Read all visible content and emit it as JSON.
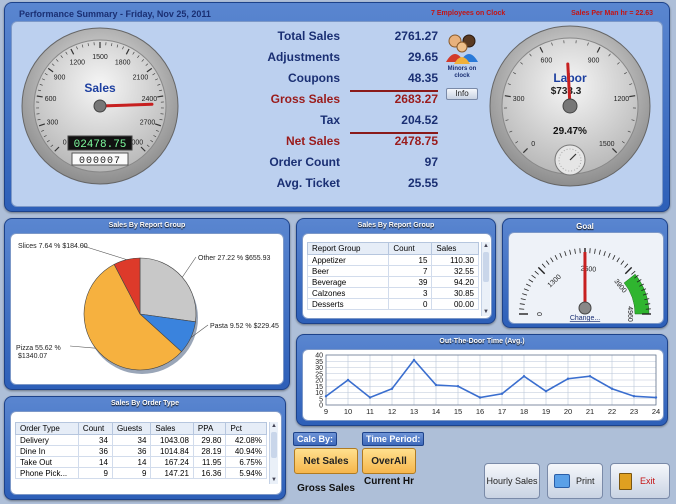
{
  "header": {
    "title": "Performance Summary - Friday, Nov 25, 2011",
    "employees": "7 Employees on Clock",
    "sales_per_man_hr": "Sales Per Man hr = 22.63"
  },
  "sales_gauge": {
    "label": "Sales",
    "ticks": [
      "0",
      "300",
      "600",
      "900",
      "1200",
      "1500",
      "1800",
      "2100",
      "2400",
      "2700",
      "3000"
    ],
    "value": 2478.75,
    "digital": "02478.75",
    "odometer": "000007"
  },
  "summary": [
    {
      "label": "Total Sales",
      "value": "2761.27",
      "style": "blue"
    },
    {
      "label": "Adjustments",
      "value": "29.65",
      "style": "blue"
    },
    {
      "label": "Coupons",
      "value": "48.35",
      "style": "blue"
    },
    {
      "label": "Gross Sales",
      "value": "2683.27",
      "style": "red"
    },
    {
      "label": "Tax",
      "value": "204.52",
      "style": "blue"
    },
    {
      "label": "Net Sales",
      "value": "2478.75",
      "style": "red"
    },
    {
      "label": "Order Count",
      "value": "97",
      "style": "blue"
    },
    {
      "label": "Avg. Ticket",
      "value": "25.55",
      "style": "blue"
    }
  ],
  "minors": {
    "label": "Minors on clock",
    "info_button": "Info"
  },
  "labor_gauge": {
    "label": "Labor",
    "amount": "$733.3",
    "ticks": [
      "0",
      "300",
      "600",
      "900",
      "1200",
      "1500"
    ],
    "percent": "29.47%",
    "value": 733.3
  },
  "pie": {
    "title": "Sales By Report Group",
    "chart_data": {
      "type": "pie",
      "slices": [
        {
          "name": "Other",
          "pct": 27.22,
          "amount": "$655.93",
          "label": "Other  27.22 % $655.93",
          "color": "#c8c8c8"
        },
        {
          "name": "Pasta",
          "pct": 9.52,
          "amount": "$229.45",
          "label": "Pasta 9.52 % $229.45",
          "color": "#3a83dd"
        },
        {
          "name": "Pizza",
          "pct": 55.62,
          "amount": "$1340.07",
          "label": "Pizza 55.62 % $1340.07",
          "color": "#f6b13f"
        },
        {
          "name": "Slices",
          "pct": 7.64,
          "amount": "$184.00",
          "label": "Slices 7.64 % $184.00",
          "color": "#dd3a2a"
        }
      ]
    }
  },
  "report_table": {
    "title": "Sales By Report Group",
    "headers": [
      "Report Group",
      "Count",
      "Sales"
    ],
    "rows": [
      [
        "Appetizer",
        "15",
        "110.30"
      ],
      [
        "Beer",
        "7",
        "32.55"
      ],
      [
        "Beverage",
        "39",
        "94.20"
      ],
      [
        "Calzones",
        "3",
        "30.85"
      ],
      [
        "Desserts",
        "0",
        "00.00"
      ]
    ]
  },
  "goal": {
    "title": "Goal",
    "ticks": [
      "0",
      "1300",
      "2600",
      "3900",
      "4960"
    ],
    "value": 2478.75,
    "change_link": "Change..."
  },
  "otd": {
    "title": "Out-The-Door Time (Avg.)",
    "chart_data": {
      "type": "line",
      "x": [
        9,
        10,
        11,
        12,
        13,
        14,
        15,
        16,
        17,
        18,
        19,
        20,
        21,
        22,
        23,
        24
      ],
      "y": [
        7,
        20,
        6,
        13,
        36,
        16,
        15,
        6,
        9,
        23,
        11,
        21,
        23,
        13,
        7,
        6
      ],
      "ylim": [
        0,
        40
      ],
      "yticks": [
        0,
        5,
        10,
        15,
        20,
        25,
        30,
        35,
        40
      ],
      "grid": true
    }
  },
  "order_table": {
    "title": "Sales By Order Type",
    "headers": [
      "Order Type",
      "Count",
      "Guests",
      "Sales",
      "PPA",
      "Pct"
    ],
    "rows": [
      [
        "Delivery",
        "34",
        "34",
        "1043.08",
        "29.80",
        "42.08%"
      ],
      [
        "Dine In",
        "36",
        "36",
        "1014.84",
        "28.19",
        "40.94%"
      ],
      [
        "Take Out",
        "14",
        "14",
        "167.24",
        "11.95",
        "6.75%"
      ],
      [
        "Phone Pick...",
        "9",
        "9",
        "147.21",
        "16.36",
        "5.94%"
      ]
    ]
  },
  "controls": {
    "calc_by": "Calc By:",
    "time_period": "Time Period:",
    "net_sales": "Net Sales",
    "gross_sales": "Gross Sales",
    "overall": "OverAll",
    "current_hr": "Current Hr",
    "hourly_sales": "Hourly Sales",
    "print": "Print",
    "exit": "Exit"
  }
}
